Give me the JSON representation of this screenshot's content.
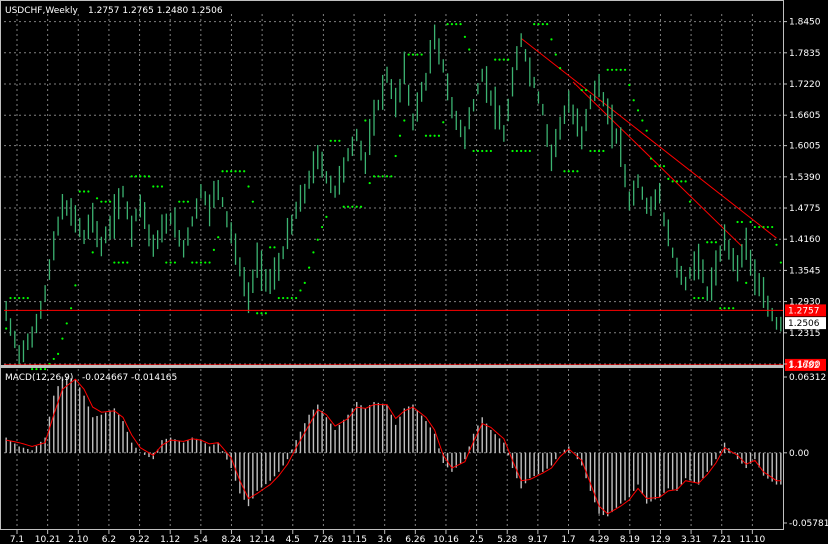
{
  "window": {
    "symbol_label": "USDCHF,Weekly",
    "ohlc_label": "1.2757 1.2765 1.2480 1.2506"
  },
  "indicator": {
    "label": "MACD(12,26,9)",
    "values_label": "-0.024667 -0.014165"
  },
  "colors": {
    "background": "#000000",
    "grid": "#808080",
    "price_bars": "#3cb371",
    "sar_dots": "#00ff00",
    "trendline": "#ff0000",
    "macd_histogram": "#c0c0c0",
    "signal_line": "#ff0000",
    "current_price_box": "#ffffff",
    "level_box": "#ff0000"
  },
  "chart_data": [
    {
      "type": "line",
      "title": "USDCHF,Weekly",
      "ylim": [
        1.17,
        1.86
      ],
      "y_ticks": [
        "1.8450",
        "1.7835",
        "1.7220",
        "1.6605",
        "1.6005",
        "1.5390",
        "1.4775",
        "1.4160",
        "1.3545",
        "1.2930",
        "1.2315",
        "1.1700"
      ],
      "x_ticks": [
        "7.1",
        "10.21",
        "2.10",
        "6.2",
        "9.22",
        "1.12",
        "5.4",
        "8.24",
        "12.14",
        "4.5",
        "7.26",
        "11.15",
        "3.6",
        "6.26",
        "10.16",
        "2.5",
        "5.28",
        "9.17",
        "1.7",
        "4.29",
        "8.19",
        "12.9",
        "3.31",
        "7.21",
        "11.10"
      ],
      "current_price_label": "1.2506",
      "horizontal_levels": [
        {
          "label": "1.2757",
          "value": 1.2757
        },
        {
          "label": "1.1682",
          "value": 1.1682
        }
      ],
      "trendlines": [
        {
          "from": [
            119,
            1.812
          ],
          "to": [
            178,
            1.418
          ]
        },
        {
          "from": [
            131,
            1.726
          ],
          "to": [
            170,
            1.402
          ]
        }
      ],
      "series": [
        {
          "x": [
            0,
            3,
            6,
            9,
            11,
            13,
            16,
            18,
            20,
            22,
            25,
            27,
            29,
            31,
            34,
            36,
            38,
            41,
            43,
            45,
            47,
            49,
            52,
            54,
            56,
            58,
            61,
            63,
            65,
            67,
            70,
            72,
            74,
            76,
            79,
            81,
            83,
            85,
            88,
            90,
            92,
            94,
            97,
            99,
            101,
            103,
            106,
            108,
            110,
            112,
            115,
            117,
            119,
            121,
            124,
            126,
            128,
            130,
            133,
            135,
            137,
            139,
            142,
            144,
            146,
            148,
            151,
            153,
            155,
            157,
            160,
            162,
            164,
            166,
            169,
            171,
            173,
            175,
            178
          ],
          "values": [
            1.27,
            1.19,
            1.22,
            1.31,
            1.4,
            1.48,
            1.46,
            1.42,
            1.46,
            1.4,
            1.46,
            1.51,
            1.44,
            1.49,
            1.4,
            1.43,
            1.46,
            1.4,
            1.45,
            1.51,
            1.48,
            1.52,
            1.43,
            1.36,
            1.3,
            1.37,
            1.33,
            1.36,
            1.42,
            1.47,
            1.53,
            1.58,
            1.54,
            1.51,
            1.58,
            1.62,
            1.57,
            1.65,
            1.74,
            1.68,
            1.75,
            1.65,
            1.73,
            1.81,
            1.76,
            1.67,
            1.62,
            1.68,
            1.74,
            1.7,
            1.62,
            1.72,
            1.81,
            1.75,
            1.67,
            1.58,
            1.64,
            1.68,
            1.62,
            1.69,
            1.72,
            1.66,
            1.6,
            1.49,
            1.53,
            1.48,
            1.5,
            1.42,
            1.36,
            1.33,
            1.38,
            1.31,
            1.35,
            1.42,
            1.36,
            1.41,
            1.34,
            1.3,
            1.25
          ]
        }
      ]
    },
    {
      "type": "bar",
      "title": "MACD(12,26,9)",
      "ylim": [
        -0.06,
        0.066
      ],
      "y_ticks": [
        "0.06312",
        "0.00",
        "-0.05781"
      ],
      "series": [
        {
          "name": "MACD",
          "x": [
            0,
            3,
            6,
            9,
            11,
            13,
            16,
            18,
            20,
            22,
            25,
            27,
            29,
            31,
            34,
            36,
            38,
            41,
            43,
            45,
            47,
            49,
            52,
            54,
            56,
            58,
            61,
            63,
            65,
            67,
            70,
            72,
            74,
            76,
            79,
            81,
            83,
            85,
            88,
            90,
            92,
            94,
            97,
            99,
            101,
            103,
            106,
            108,
            110,
            112,
            115,
            117,
            119,
            121,
            124,
            126,
            128,
            130,
            133,
            135,
            137,
            139,
            142,
            144,
            146,
            148,
            151,
            153,
            155,
            157,
            160,
            162,
            164,
            166,
            169,
            171,
            173,
            175,
            178
          ],
          "values": [
            0.012,
            0.005,
            0.002,
            0.012,
            0.045,
            0.06,
            0.058,
            0.045,
            0.028,
            0.03,
            0.035,
            0.025,
            0.008,
            0.0,
            -0.005,
            0.01,
            0.012,
            0.008,
            0.012,
            0.01,
            0.005,
            0.008,
            -0.012,
            -0.032,
            -0.042,
            -0.03,
            -0.022,
            -0.015,
            -0.005,
            0.01,
            0.03,
            0.038,
            0.028,
            0.018,
            0.03,
            0.04,
            0.035,
            0.04,
            0.038,
            0.022,
            0.035,
            0.038,
            0.025,
            0.015,
            -0.008,
            -0.015,
            -0.005,
            0.015,
            0.028,
            0.018,
            0.008,
            -0.012,
            -0.028,
            -0.02,
            -0.015,
            -0.01,
            0.0,
            0.005,
            -0.01,
            -0.03,
            -0.048,
            -0.05,
            -0.04,
            -0.035,
            -0.025,
            -0.04,
            -0.035,
            -0.028,
            -0.03,
            -0.02,
            -0.025,
            -0.015,
            -0.005,
            0.008,
            -0.005,
            -0.012,
            -0.005,
            -0.018,
            -0.025
          ]
        },
        {
          "name": "Signal",
          "x": [
            0,
            3,
            6,
            9,
            11,
            13,
            16,
            18,
            20,
            22,
            25,
            27,
            29,
            31,
            34,
            36,
            38,
            41,
            43,
            45,
            47,
            49,
            52,
            54,
            56,
            58,
            61,
            63,
            65,
            67,
            70,
            72,
            74,
            76,
            79,
            81,
            83,
            85,
            88,
            90,
            92,
            94,
            97,
            99,
            101,
            103,
            106,
            108,
            110,
            112,
            115,
            117,
            119,
            121,
            124,
            126,
            128,
            130,
            133,
            135,
            137,
            139,
            142,
            144,
            146,
            148,
            151,
            153,
            155,
            157,
            160,
            162,
            164,
            166,
            169,
            171,
            173,
            175,
            178
          ],
          "values": [
            0.01,
            0.008,
            0.005,
            0.008,
            0.03,
            0.05,
            0.058,
            0.05,
            0.036,
            0.032,
            0.033,
            0.028,
            0.014,
            0.004,
            -0.002,
            0.006,
            0.01,
            0.009,
            0.011,
            0.01,
            0.007,
            0.008,
            -0.004,
            -0.022,
            -0.036,
            -0.032,
            -0.025,
            -0.018,
            -0.009,
            0.004,
            0.022,
            0.034,
            0.03,
            0.021,
            0.027,
            0.036,
            0.035,
            0.038,
            0.038,
            0.027,
            0.033,
            0.036,
            0.028,
            0.018,
            -0.002,
            -0.012,
            -0.007,
            0.009,
            0.023,
            0.02,
            0.011,
            -0.006,
            -0.022,
            -0.021,
            -0.016,
            -0.012,
            -0.003,
            0.003,
            -0.006,
            -0.024,
            -0.042,
            -0.048,
            -0.042,
            -0.037,
            -0.028,
            -0.036,
            -0.035,
            -0.03,
            -0.029,
            -0.022,
            -0.024,
            -0.017,
            -0.008,
            0.004,
            -0.002,
            -0.009,
            -0.006,
            -0.015,
            -0.022
          ]
        }
      ]
    }
  ]
}
